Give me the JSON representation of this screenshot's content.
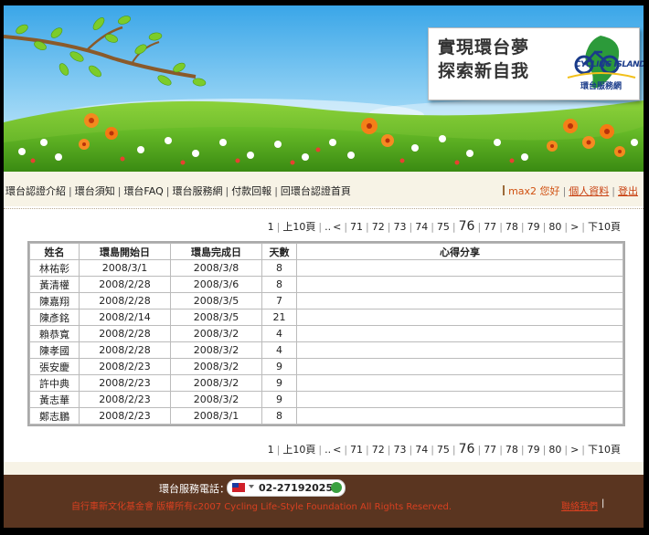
{
  "banner": {
    "slogan_line1": "實現環台夢",
    "slogan_line2": "探索新自我",
    "logo_en": "CYCLING ISLAND",
    "logo_zh": "環台服務網"
  },
  "nav": {
    "items": [
      "環台認證介紹",
      "環台須知",
      "環台FAQ",
      "環台服務網",
      "付款回報",
      "回環台認證首頁"
    ]
  },
  "user": {
    "greeting": "max2 您好",
    "profile": "個人資料",
    "logout": "登出"
  },
  "pager": {
    "first": "1",
    "prev10": "上10頁",
    "ellipsis": "..",
    "prev": "<",
    "pages": [
      "71",
      "72",
      "73",
      "74",
      "75",
      "76",
      "77",
      "78",
      "79",
      "80"
    ],
    "current": "76",
    "next": ">",
    "next10": "下10頁"
  },
  "table": {
    "headers": [
      "姓名",
      "環島開始日",
      "環島完成日",
      "天數",
      "心得分享"
    ],
    "rows": [
      [
        "林祐彰",
        "2008/3/1",
        "2008/3/8",
        "8",
        ""
      ],
      [
        "黃清權",
        "2008/2/28",
        "2008/3/6",
        "8",
        ""
      ],
      [
        "陳嘉翔",
        "2008/2/28",
        "2008/3/5",
        "7",
        ""
      ],
      [
        "陳彥銘",
        "2008/2/14",
        "2008/3/5",
        "21",
        ""
      ],
      [
        "賴恭寬",
        "2008/2/28",
        "2008/3/2",
        "4",
        ""
      ],
      [
        "陳孝國",
        "2008/2/28",
        "2008/3/2",
        "4",
        ""
      ],
      [
        "張安慶",
        "2008/2/23",
        "2008/3/2",
        "9",
        ""
      ],
      [
        "許中典",
        "2008/2/23",
        "2008/3/2",
        "9",
        ""
      ],
      [
        "黃志華",
        "2008/2/23",
        "2008/3/2",
        "9",
        ""
      ],
      [
        "鄭志鵬",
        "2008/2/23",
        "2008/3/1",
        "8",
        ""
      ]
    ]
  },
  "footer": {
    "phone_label": "環台服務電話：",
    "phone_number": "02-27192025",
    "copyright": "自行車新文化基金會 版權所有c2007 Cycling Life-Style Foundation All Rights Reserved.",
    "contact": "聯絡我們",
    "contact_sep": "|"
  },
  "colors": {
    "nav_bg": "#f7f3e6",
    "footer_bg": "#5a3520",
    "accent": "#d84020"
  }
}
